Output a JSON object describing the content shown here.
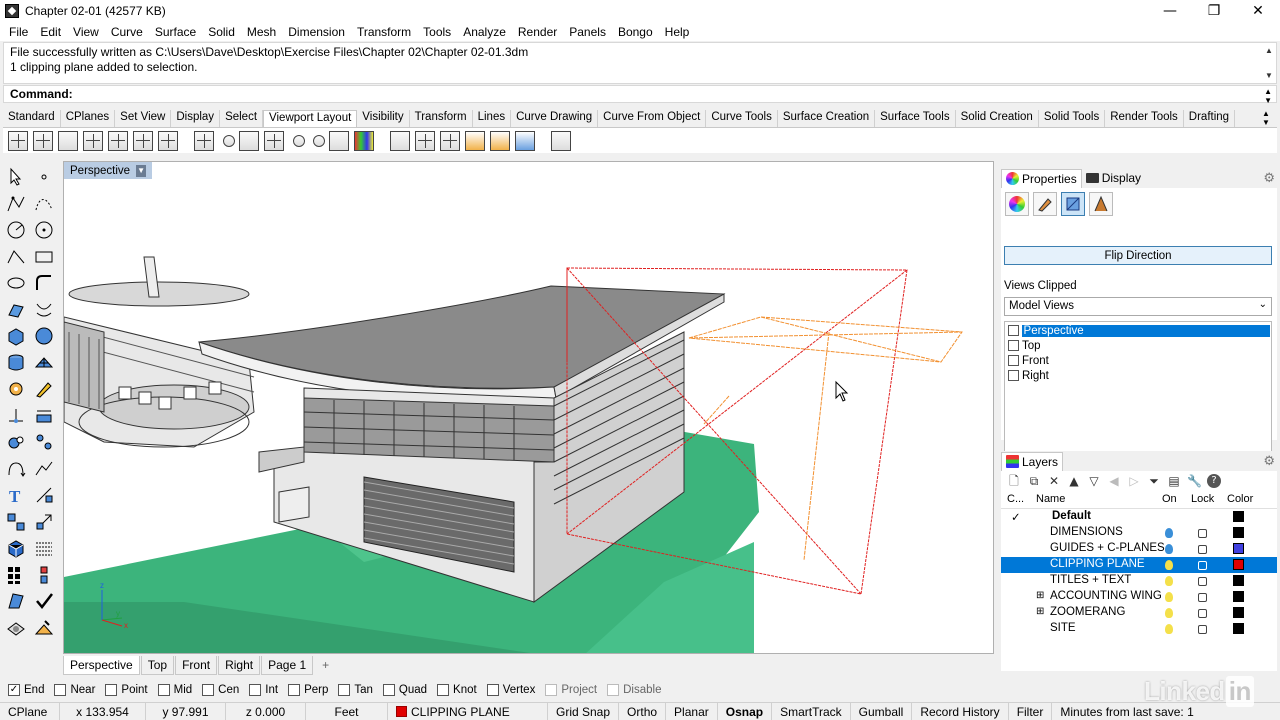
{
  "window": {
    "title": "Chapter 02-01 (42577 KB)",
    "minimize": "—",
    "maximize": "❐",
    "close": "✕"
  },
  "menu": [
    "File",
    "Edit",
    "View",
    "Curve",
    "Surface",
    "Solid",
    "Mesh",
    "Dimension",
    "Transform",
    "Tools",
    "Analyze",
    "Render",
    "Panels",
    "Bongo",
    "Help"
  ],
  "command_history": [
    "File successfully written as C:\\Users\\Dave\\Desktop\\Exercise Files\\Chapter 02\\Chapter 02-01.3dm",
    "1 clipping plane added to selection."
  ],
  "command_prompt": {
    "label": "Command:",
    "value": ""
  },
  "toolbar_tabs": [
    "Standard",
    "CPlanes",
    "Set View",
    "Display",
    "Select",
    "Viewport Layout",
    "Visibility",
    "Transform",
    "Lines",
    "Curve Drawing",
    "Curve From Object",
    "Curve Tools",
    "Surface Creation",
    "Surface Tools",
    "Solid Creation",
    "Solid Tools",
    "Render Tools",
    "Drafting"
  ],
  "active_toolbar_tab": "Viewport Layout",
  "viewport": {
    "label": "Perspective",
    "tabs": [
      "Perspective",
      "Top",
      "Front",
      "Right",
      "Page 1"
    ],
    "add_tab": "+",
    "axis": {
      "x": "x",
      "y": "y",
      "z": "z"
    }
  },
  "osnap": [
    {
      "label": "End",
      "checked": true
    },
    {
      "label": "Near",
      "checked": false
    },
    {
      "label": "Point",
      "checked": false
    },
    {
      "label": "Mid",
      "checked": false
    },
    {
      "label": "Cen",
      "checked": false
    },
    {
      "label": "Int",
      "checked": false
    },
    {
      "label": "Perp",
      "checked": false
    },
    {
      "label": "Tan",
      "checked": false
    },
    {
      "label": "Quad",
      "checked": false
    },
    {
      "label": "Knot",
      "checked": false
    },
    {
      "label": "Vertex",
      "checked": false
    },
    {
      "label": "Project",
      "checked": false,
      "disabled": true
    },
    {
      "label": "Disable",
      "checked": false,
      "disabled": true
    }
  ],
  "statusbar": {
    "cplane": "CPlane",
    "x": "x 133.954",
    "y": "y 97.991",
    "z": "z 0.000",
    "units": "Feet",
    "layer": "CLIPPING PLANE",
    "layer_color": "#e00000",
    "grid_snap": "Grid Snap",
    "ortho": "Ortho",
    "planar": "Planar",
    "osnap": "Osnap",
    "smarttrack": "SmartTrack",
    "gumball": "Gumball",
    "record_history": "Record History",
    "filter": "Filter",
    "minutes": "Minutes from last save: 1"
  },
  "properties_panel": {
    "tab_properties": "Properties",
    "tab_display": "Display",
    "flip_button": "Flip Direction",
    "views_clipped_label": "Views Clipped",
    "views_select": "Model Views",
    "views": [
      {
        "label": "Perspective",
        "checked": false,
        "selected": true
      },
      {
        "label": "Top",
        "checked": false,
        "selected": false
      },
      {
        "label": "Front",
        "checked": false,
        "selected": false
      },
      {
        "label": "Right",
        "checked": false,
        "selected": false
      }
    ]
  },
  "layers_panel": {
    "title": "Layers",
    "columns": {
      "current": "C...",
      "name": "Name",
      "on": "On",
      "lock": "Lock",
      "color": "Color"
    },
    "layers": [
      {
        "name": "Default",
        "current": true,
        "bold": true,
        "color": "#000000",
        "expand": ""
      },
      {
        "name": "DIMENSIONS",
        "color": "#000000",
        "bulb": "#3a8fd8",
        "expand": ""
      },
      {
        "name": "GUIDES + C-PLANES",
        "color": "#4040e0",
        "bulb": "#3a8fd8",
        "expand": ""
      },
      {
        "name": "CLIPPING PLANE",
        "color": "#e00000",
        "bulb": "#f4e04a",
        "selected": true,
        "expand": ""
      },
      {
        "name": "TITLES + TEXT",
        "color": "#000000",
        "bulb": "#f4e04a",
        "expand": ""
      },
      {
        "name": "ACCOUNTING WING",
        "color": "#000000",
        "bulb": "#f4e04a",
        "expand": "⊞"
      },
      {
        "name": "ZOOMERANG",
        "color": "#000000",
        "bulb": "#f4e04a",
        "expand": "⊞"
      },
      {
        "name": "SITE",
        "color": "#000000",
        "bulb": "#f4e04a",
        "expand": ""
      }
    ]
  },
  "watermark": {
    "text": "Linked",
    "badge": "in"
  }
}
